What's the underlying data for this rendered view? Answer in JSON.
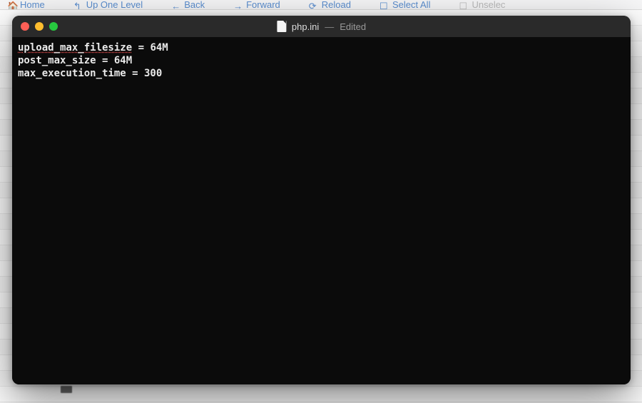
{
  "background": {
    "toolbar_items": [
      "Home",
      "Up One Level",
      "Back",
      "Forward",
      "Reload",
      "Select All",
      "Unselec"
    ]
  },
  "window": {
    "filename": "php.ini",
    "status": "Edited"
  },
  "code": {
    "line1_a": "upload_max_filesize",
    "line1_b": " = 64M",
    "line2": "post_max_size = 64M",
    "line3": "max_execution_time = 300"
  }
}
